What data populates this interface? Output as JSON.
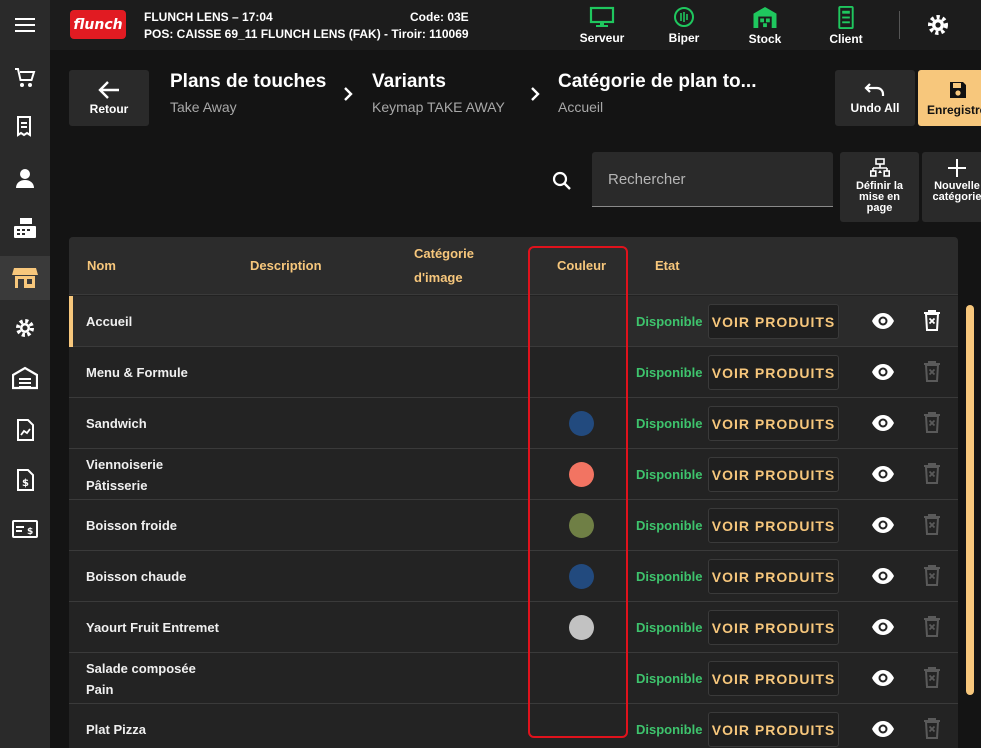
{
  "header": {
    "logo_text": "flunch",
    "store_line1": "FLUNCH LENS – 17:04",
    "store_line2": "POS: CAISSE 69_11 FLUNCH LENS (FAK) - Tiroir: 110069",
    "code": "Code: 03E",
    "tools": [
      {
        "label": "Serveur",
        "icon": "monitor-icon"
      },
      {
        "label": "Biper",
        "icon": "pager-icon"
      },
      {
        "label": "Stock",
        "icon": "warehouse-icon"
      },
      {
        "label": "Client",
        "icon": "client-device-icon"
      }
    ],
    "accent_green": "#1fc75e"
  },
  "breadcrumb": {
    "back_label": "Retour",
    "items": [
      {
        "title": "Plans de touches",
        "subtitle": "Take Away"
      },
      {
        "title": "Variants",
        "subtitle": "Keymap TAKE AWAY"
      },
      {
        "title": "Catégorie de plan to...",
        "subtitle": "Accueil"
      }
    ],
    "undo_label": "Undo All",
    "save_label": "Enregistrer"
  },
  "search": {
    "placeholder": "Rechercher",
    "value": ""
  },
  "actions": {
    "layout_label": "Définir la\nmise en\npage",
    "new_category_label": "Nouvelle\ncatégorie"
  },
  "table": {
    "columns": {
      "name": "Nom",
      "description": "Description",
      "image_category": "Catégorie\nd'image",
      "color": "Couleur",
      "state": "Etat"
    },
    "rows": [
      {
        "name": "Accueil",
        "color": "",
        "state": "Disponible",
        "action": "VOIR PRODUITS"
      },
      {
        "name": "Menu & Formule",
        "color": "",
        "state": "Disponible",
        "action": "VOIR PRODUITS"
      },
      {
        "name": "Sandwich",
        "color": "#224a7e",
        "state": "Disponible",
        "action": "VOIR PRODUITS"
      },
      {
        "name": "Viennoiserie\nPâtisserie",
        "color": "#f27462",
        "state": "Disponible",
        "action": "VOIR PRODUITS"
      },
      {
        "name": "Boisson froide",
        "color": "#6f7f45",
        "state": "Disponible",
        "action": "VOIR PRODUITS"
      },
      {
        "name": "Boisson chaude",
        "color": "#224a7e",
        "state": "Disponible",
        "action": "VOIR PRODUITS"
      },
      {
        "name": "Yaourt Fruit Entremet",
        "color": "#c2c2c2",
        "state": "Disponible",
        "action": "VOIR PRODUITS"
      },
      {
        "name": "Salade composée\nPain",
        "color": "",
        "state": "Disponible",
        "action": "VOIR PRODUITS"
      },
      {
        "name": "Plat Pizza",
        "color": "",
        "state": "Disponible",
        "action": "VOIR PRODUITS"
      }
    ],
    "accent": "#f7c77c",
    "status_color": "#3ec46d"
  }
}
